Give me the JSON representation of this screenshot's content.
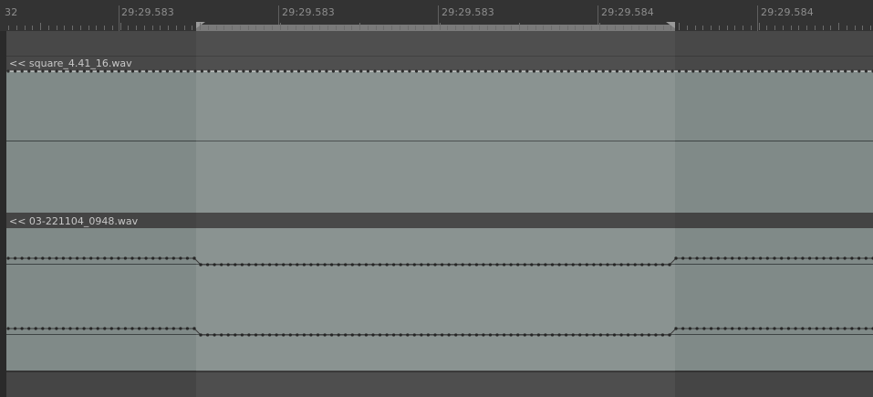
{
  "ruler": {
    "cut_label": "32",
    "labels": [
      "29:29.583",
      "29:29.583",
      "29:29.583",
      "29:29.584",
      "29:29.584"
    ]
  },
  "tracks": [
    {
      "clip_name": "<< square_4.41_16.wav"
    },
    {
      "clip_name": "<< 03-221104_0948.wav"
    }
  ],
  "colors": {
    "waveform_bg": "#808a88",
    "selection_tint": "#8c9694",
    "header_bg": "#484848",
    "ruler_bg": "#333333"
  },
  "icons": {
    "selection_start": "triangle-marker",
    "selection_end": "triangle-marker"
  }
}
